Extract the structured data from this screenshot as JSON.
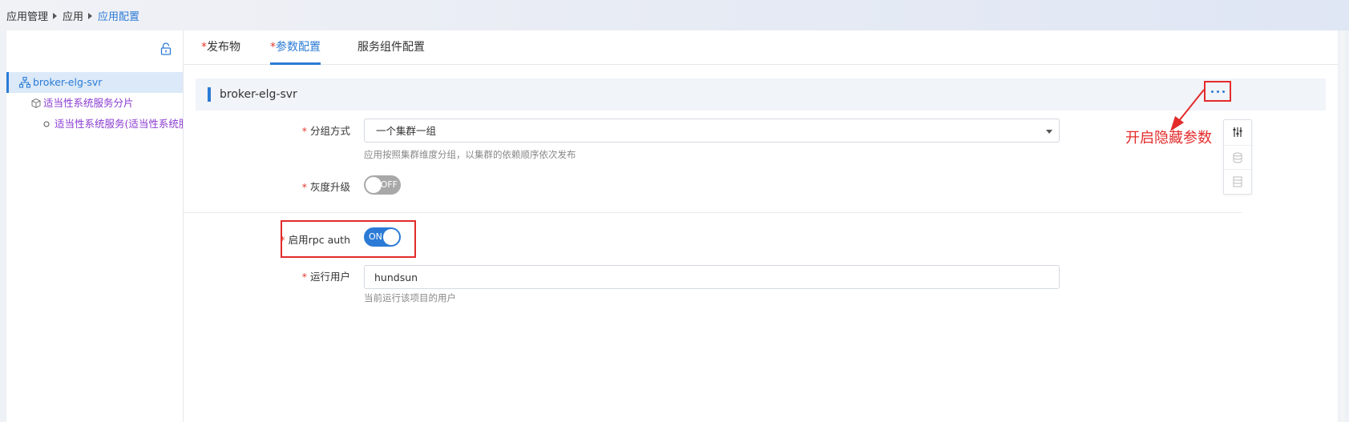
{
  "breadcrumb": {
    "items": [
      "应用管理",
      "应用",
      "应用配置"
    ]
  },
  "tree": {
    "root": "broker-elg-svr",
    "shard": "适当性系统服务分片",
    "service": "适当性系统服务(适当性系统服务"
  },
  "tabs": {
    "t1_req": "*",
    "t1": "发布物",
    "t2_req": "*",
    "t2": "参数配置",
    "t3": "服务组件配置"
  },
  "section": {
    "title": "broker-elg-svr"
  },
  "fields": {
    "group_mode": {
      "required": "*",
      "label": "分组方式",
      "value": "一个集群一组",
      "help": "应用按照集群维度分组，以集群的依赖顺序依次发布"
    },
    "gray_upgrade": {
      "required": "*",
      "label": "灰度升级",
      "state": "OFF"
    },
    "rpc_auth": {
      "required": "*",
      "label": "启用rpc auth",
      "state": "ON"
    },
    "run_user": {
      "required": "*",
      "label": "运行用户",
      "value": "hundsun",
      "help": "当前运行该项目的用户"
    }
  },
  "annotation": {
    "text": "开启隐藏参数"
  },
  "icons": {
    "lock": "lock-icon",
    "org": "org-tree-icon",
    "cube": "cube-icon",
    "circle": "circle-icon",
    "more": "more-dots-icon",
    "sliders": "sliders-icon",
    "database": "database-icon",
    "server": "server-icon"
  },
  "colors": {
    "accent": "#2b7bd6",
    "required": "#e0392f",
    "annotation": "#e32b2b",
    "tree_node": "#8a3bd1"
  }
}
